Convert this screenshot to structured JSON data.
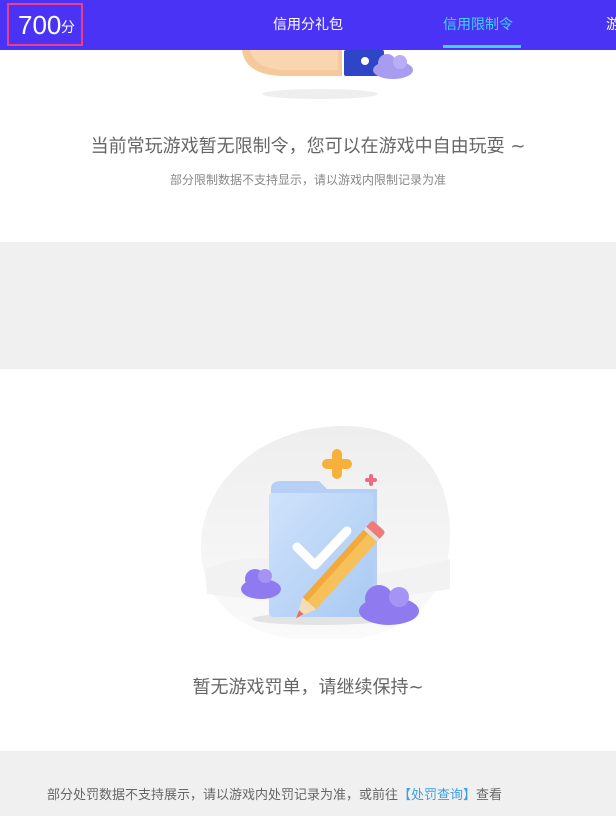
{
  "header": {
    "score_value": "700",
    "score_unit": "分",
    "tabs": [
      {
        "label": "信用分礼包",
        "active": false
      },
      {
        "label": "信用限制令",
        "active": true
      }
    ],
    "overflow_tab_glyph": "游"
  },
  "restriction_section": {
    "message": "当前常玩游戏暂无限制令，您可以在游戏中自由玩耍 ~",
    "note": "部分限制数据不支持显示，请以游戏内限制记录为准"
  },
  "penalty_section": {
    "message": "暂无游戏罚单，请继续保持~"
  },
  "footer": {
    "text_before": "部分处罚数据不支持展示，请以游戏内处罚记录为准，或前往",
    "link_label": "【处罚查询】",
    "text_after": "查看"
  },
  "colors": {
    "header_bg": "#4b33f6",
    "active_tab": "#3fd6f4",
    "highlight_border": "#e83f87",
    "link": "#3aa0e6",
    "gap_bg": "#f0f0f0"
  },
  "icons": [
    "hand-card-illustration",
    "folder-checkmark-pencil-illustration",
    "plus-sparkle-icon",
    "cloud-icon"
  ]
}
